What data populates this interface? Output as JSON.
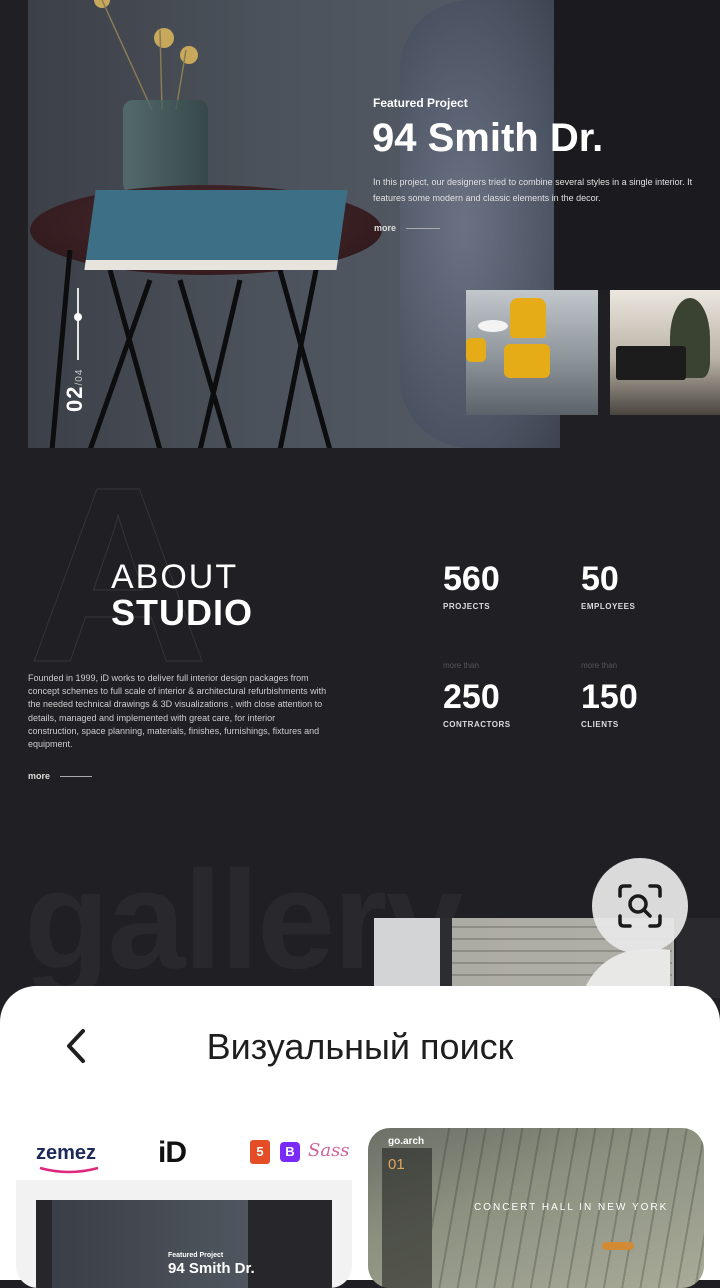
{
  "hero": {
    "label": "Featured Project",
    "title": "94 Smith Dr.",
    "description": "In this project, our designers tried to combine several styles in a single interior. It features some modern and classic elements in the decor.",
    "more": "more",
    "pager_current": "02",
    "pager_total": "/04"
  },
  "about": {
    "big_letter": "A",
    "line1": "ABOUT",
    "line2": "STUDIO",
    "description": "Founded in 1999, iD works to deliver full interior design packages from concept schemes to full scale of interior & architectural refurbishments with the needed technical drawings & 3D visualizations , with close attention to details, managed and implemented with great care, for interior construction, space planning, materials, finishes, furnishings, fixtures and equipment.",
    "more": "more",
    "stats": [
      {
        "prefix": "",
        "number": "560",
        "label": "PROJECTS"
      },
      {
        "prefix": "",
        "number": "50",
        "label": "EMPLOYEES"
      },
      {
        "prefix": "more than",
        "number": "250",
        "label": "CONTRACTORS"
      },
      {
        "prefix": "more than",
        "number": "150",
        "label": "CLIENTS"
      }
    ]
  },
  "gallery": {
    "word": "gallery"
  },
  "lens_button": {
    "icon": "visual-search-icon"
  },
  "sheet": {
    "title": "Визуальный поиск",
    "back_icon": "chevron-left-icon"
  },
  "results": [
    {
      "brand": "zemez",
      "logo": "iD",
      "badges": [
        "5",
        "B",
        "Sass"
      ],
      "label": "Featured Project",
      "title": "94 Smith Dr."
    },
    {
      "brand": "go.arch",
      "number": "01",
      "title": "CONCERT HALL IN NEW YORK"
    }
  ],
  "colors": {
    "background": "#1f1f24",
    "accent_yellow": "#e5ac18",
    "sheet": "#ffffff"
  }
}
